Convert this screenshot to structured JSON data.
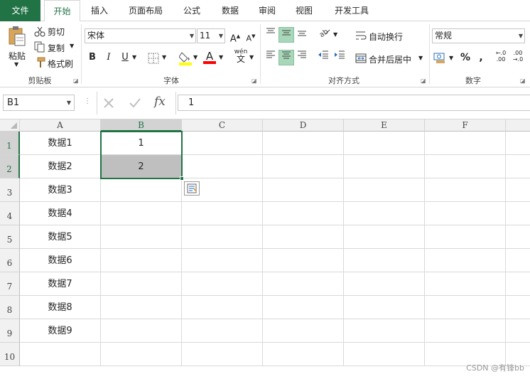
{
  "tabs": [
    {
      "label": "文件"
    },
    {
      "label": "开始"
    },
    {
      "label": "插入"
    },
    {
      "label": "页面布局"
    },
    {
      "label": "公式"
    },
    {
      "label": "数据"
    },
    {
      "label": "审阅"
    },
    {
      "label": "视图"
    },
    {
      "label": "开发工具"
    }
  ],
  "ribbon": {
    "clipboard": {
      "paste": "粘贴",
      "cut": "剪切",
      "copy": "复制",
      "format_painter": "格式刷",
      "group": "剪贴板"
    },
    "font": {
      "name": "宋体",
      "size": "11",
      "bold": "B",
      "italic": "I",
      "underline": "U",
      "phonetic": "wén",
      "group": "字体"
    },
    "alignment": {
      "wrap_text": "自动换行",
      "merge_center": "合并后居中",
      "group": "对齐方式"
    },
    "number": {
      "format": "常规",
      "percent": "%",
      "comma": ",",
      "increase_decimal": ".00",
      "decrease_decimal": ".0",
      "group": "数字"
    }
  },
  "formula_bar": {
    "name_box": "B1",
    "fx": "fx",
    "value": "1"
  },
  "columns": [
    "A",
    "B",
    "C",
    "D",
    "E",
    "F"
  ],
  "rows": [
    {
      "num": "1",
      "a": "数据1",
      "b": "1"
    },
    {
      "num": "2",
      "a": "数据2",
      "b": "2"
    },
    {
      "num": "3",
      "a": "数据3",
      "b": ""
    },
    {
      "num": "4",
      "a": "数据4",
      "b": ""
    },
    {
      "num": "5",
      "a": "数据5",
      "b": ""
    },
    {
      "num": "6",
      "a": "数据6",
      "b": ""
    },
    {
      "num": "7",
      "a": "数据7",
      "b": ""
    },
    {
      "num": "8",
      "a": "数据8",
      "b": ""
    },
    {
      "num": "9",
      "a": "数据9",
      "b": ""
    },
    {
      "num": "10",
      "a": "",
      "b": ""
    }
  ],
  "watermark": "CSDN @有锋bb",
  "colors": {
    "excel_green": "#217346",
    "selected_cell_fill": "#bfbfbf",
    "highlight_yellow": "#ffff00",
    "font_red": "#ff0000"
  }
}
